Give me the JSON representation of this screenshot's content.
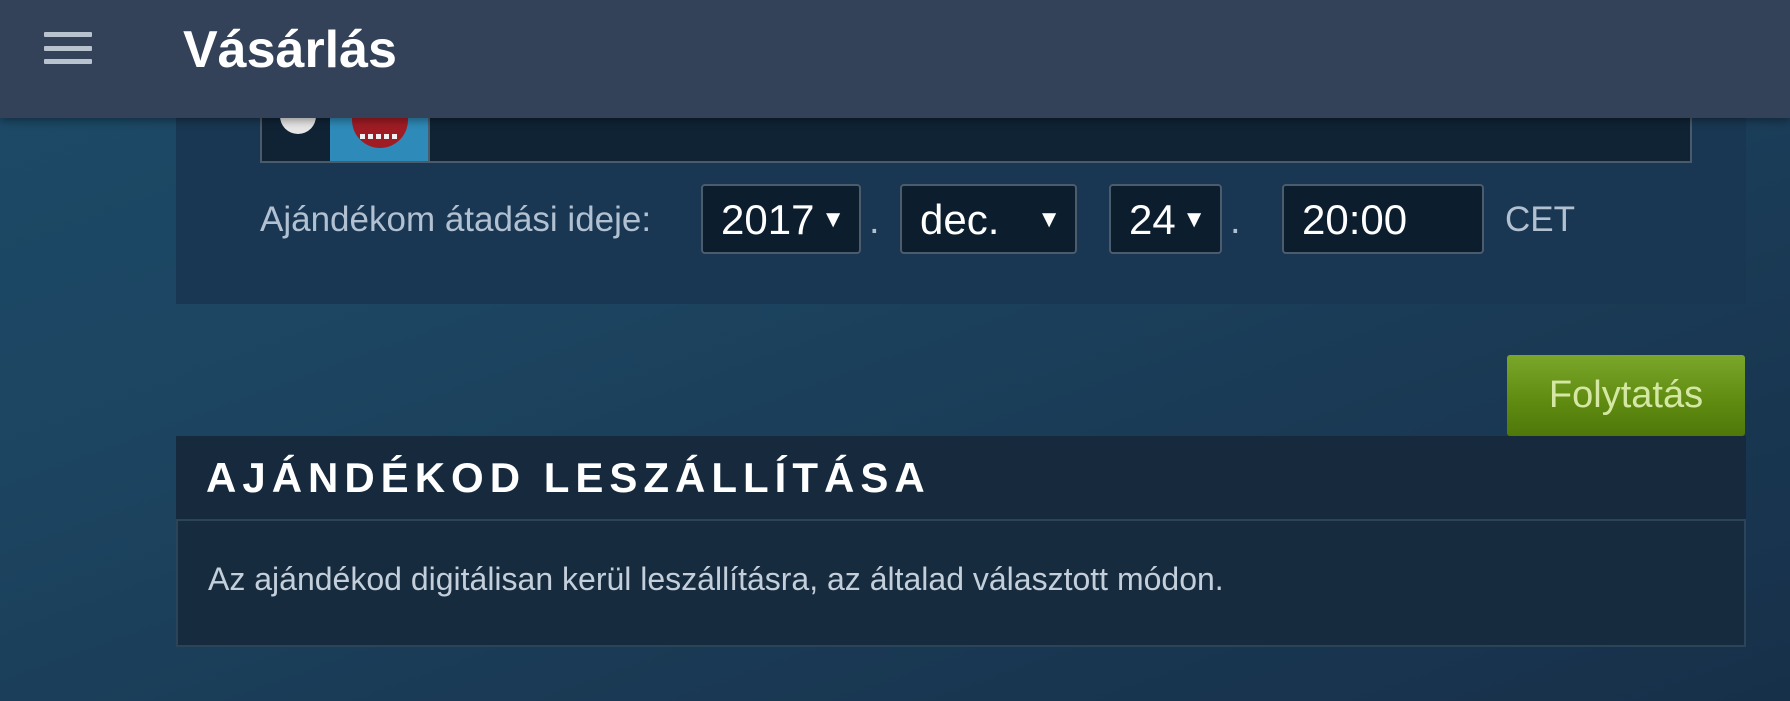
{
  "header": {
    "title": "Vásárlás",
    "menu_icon": "hamburger-menu-icon"
  },
  "gift_schedule": {
    "label": "Ajándékom átadási ideje:",
    "year": "2017",
    "month": "dec.",
    "day": "24",
    "time": "20:00",
    "timezone": "CET",
    "separator": "."
  },
  "actions": {
    "continue_label": "Folytatás"
  },
  "delivery": {
    "title": "AJÁNDÉKOD LESZÁLLÍTÁSA",
    "description": "Az ajándékod digitálisan kerül leszállításra, az általad választott módon."
  },
  "colors": {
    "appbar": "#334159",
    "continue_button": "#5e8a10",
    "panel": "#193752"
  }
}
